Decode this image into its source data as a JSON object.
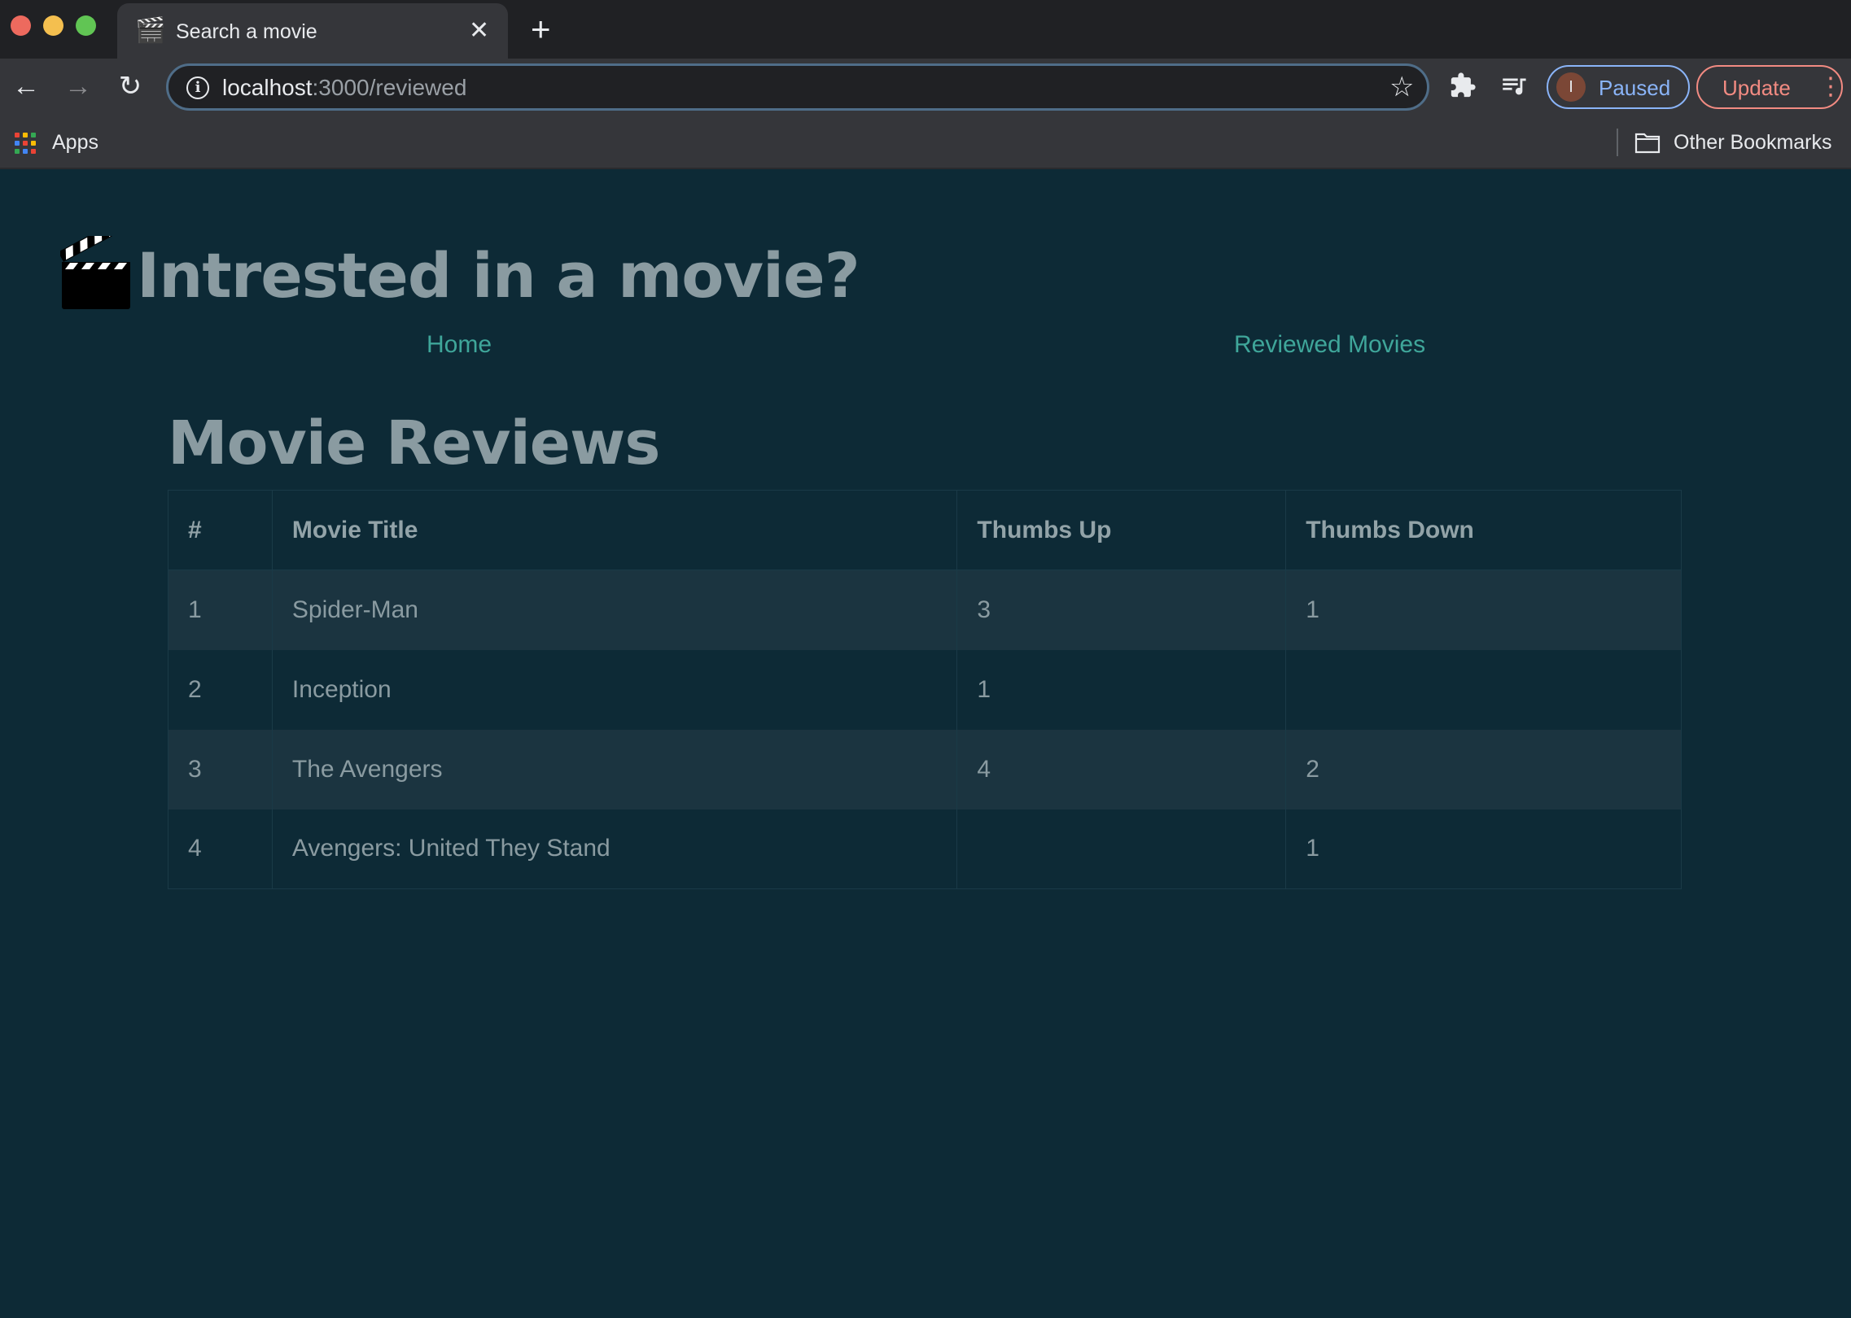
{
  "browser": {
    "tab_title": "Search a movie",
    "new_tab_symbol": "+",
    "url_host": "localhost",
    "url_rest": ":3000/reviewed",
    "profile_initial": "I",
    "profile_status": "Paused",
    "update_label": "Update",
    "bookmarks": {
      "apps_label": "Apps",
      "other_label": "Other Bookmarks"
    },
    "apps_icon_colors": [
      "#ea4335",
      "#fbbc05",
      "#34a853",
      "#4285f4",
      "#ea4335",
      "#fbbc05",
      "#34a853",
      "#4285f4",
      "#ea4335"
    ]
  },
  "page": {
    "site_title": "Intrested in a movie?",
    "nav": {
      "home": "Home",
      "reviewed": "Reviewed Movies"
    },
    "heading": "Movie Reviews",
    "table": {
      "columns": [
        "#",
        "Movie Title",
        "Thumbs Up",
        "Thumbs Down"
      ],
      "rows": [
        {
          "num": "1",
          "title": "Spider-Man",
          "up": "3",
          "down": "1"
        },
        {
          "num": "2",
          "title": "Inception",
          "up": "1",
          "down": ""
        },
        {
          "num": "3",
          "title": "The Avengers",
          "up": "4",
          "down": "2"
        },
        {
          "num": "4",
          "title": "Avengers: United They Stand",
          "up": "",
          "down": "1"
        }
      ]
    },
    "colors": {
      "background": "#0d2a36",
      "stripe": "#1b3440",
      "link": "#3fa69a",
      "text": "#8a9ba1"
    }
  }
}
